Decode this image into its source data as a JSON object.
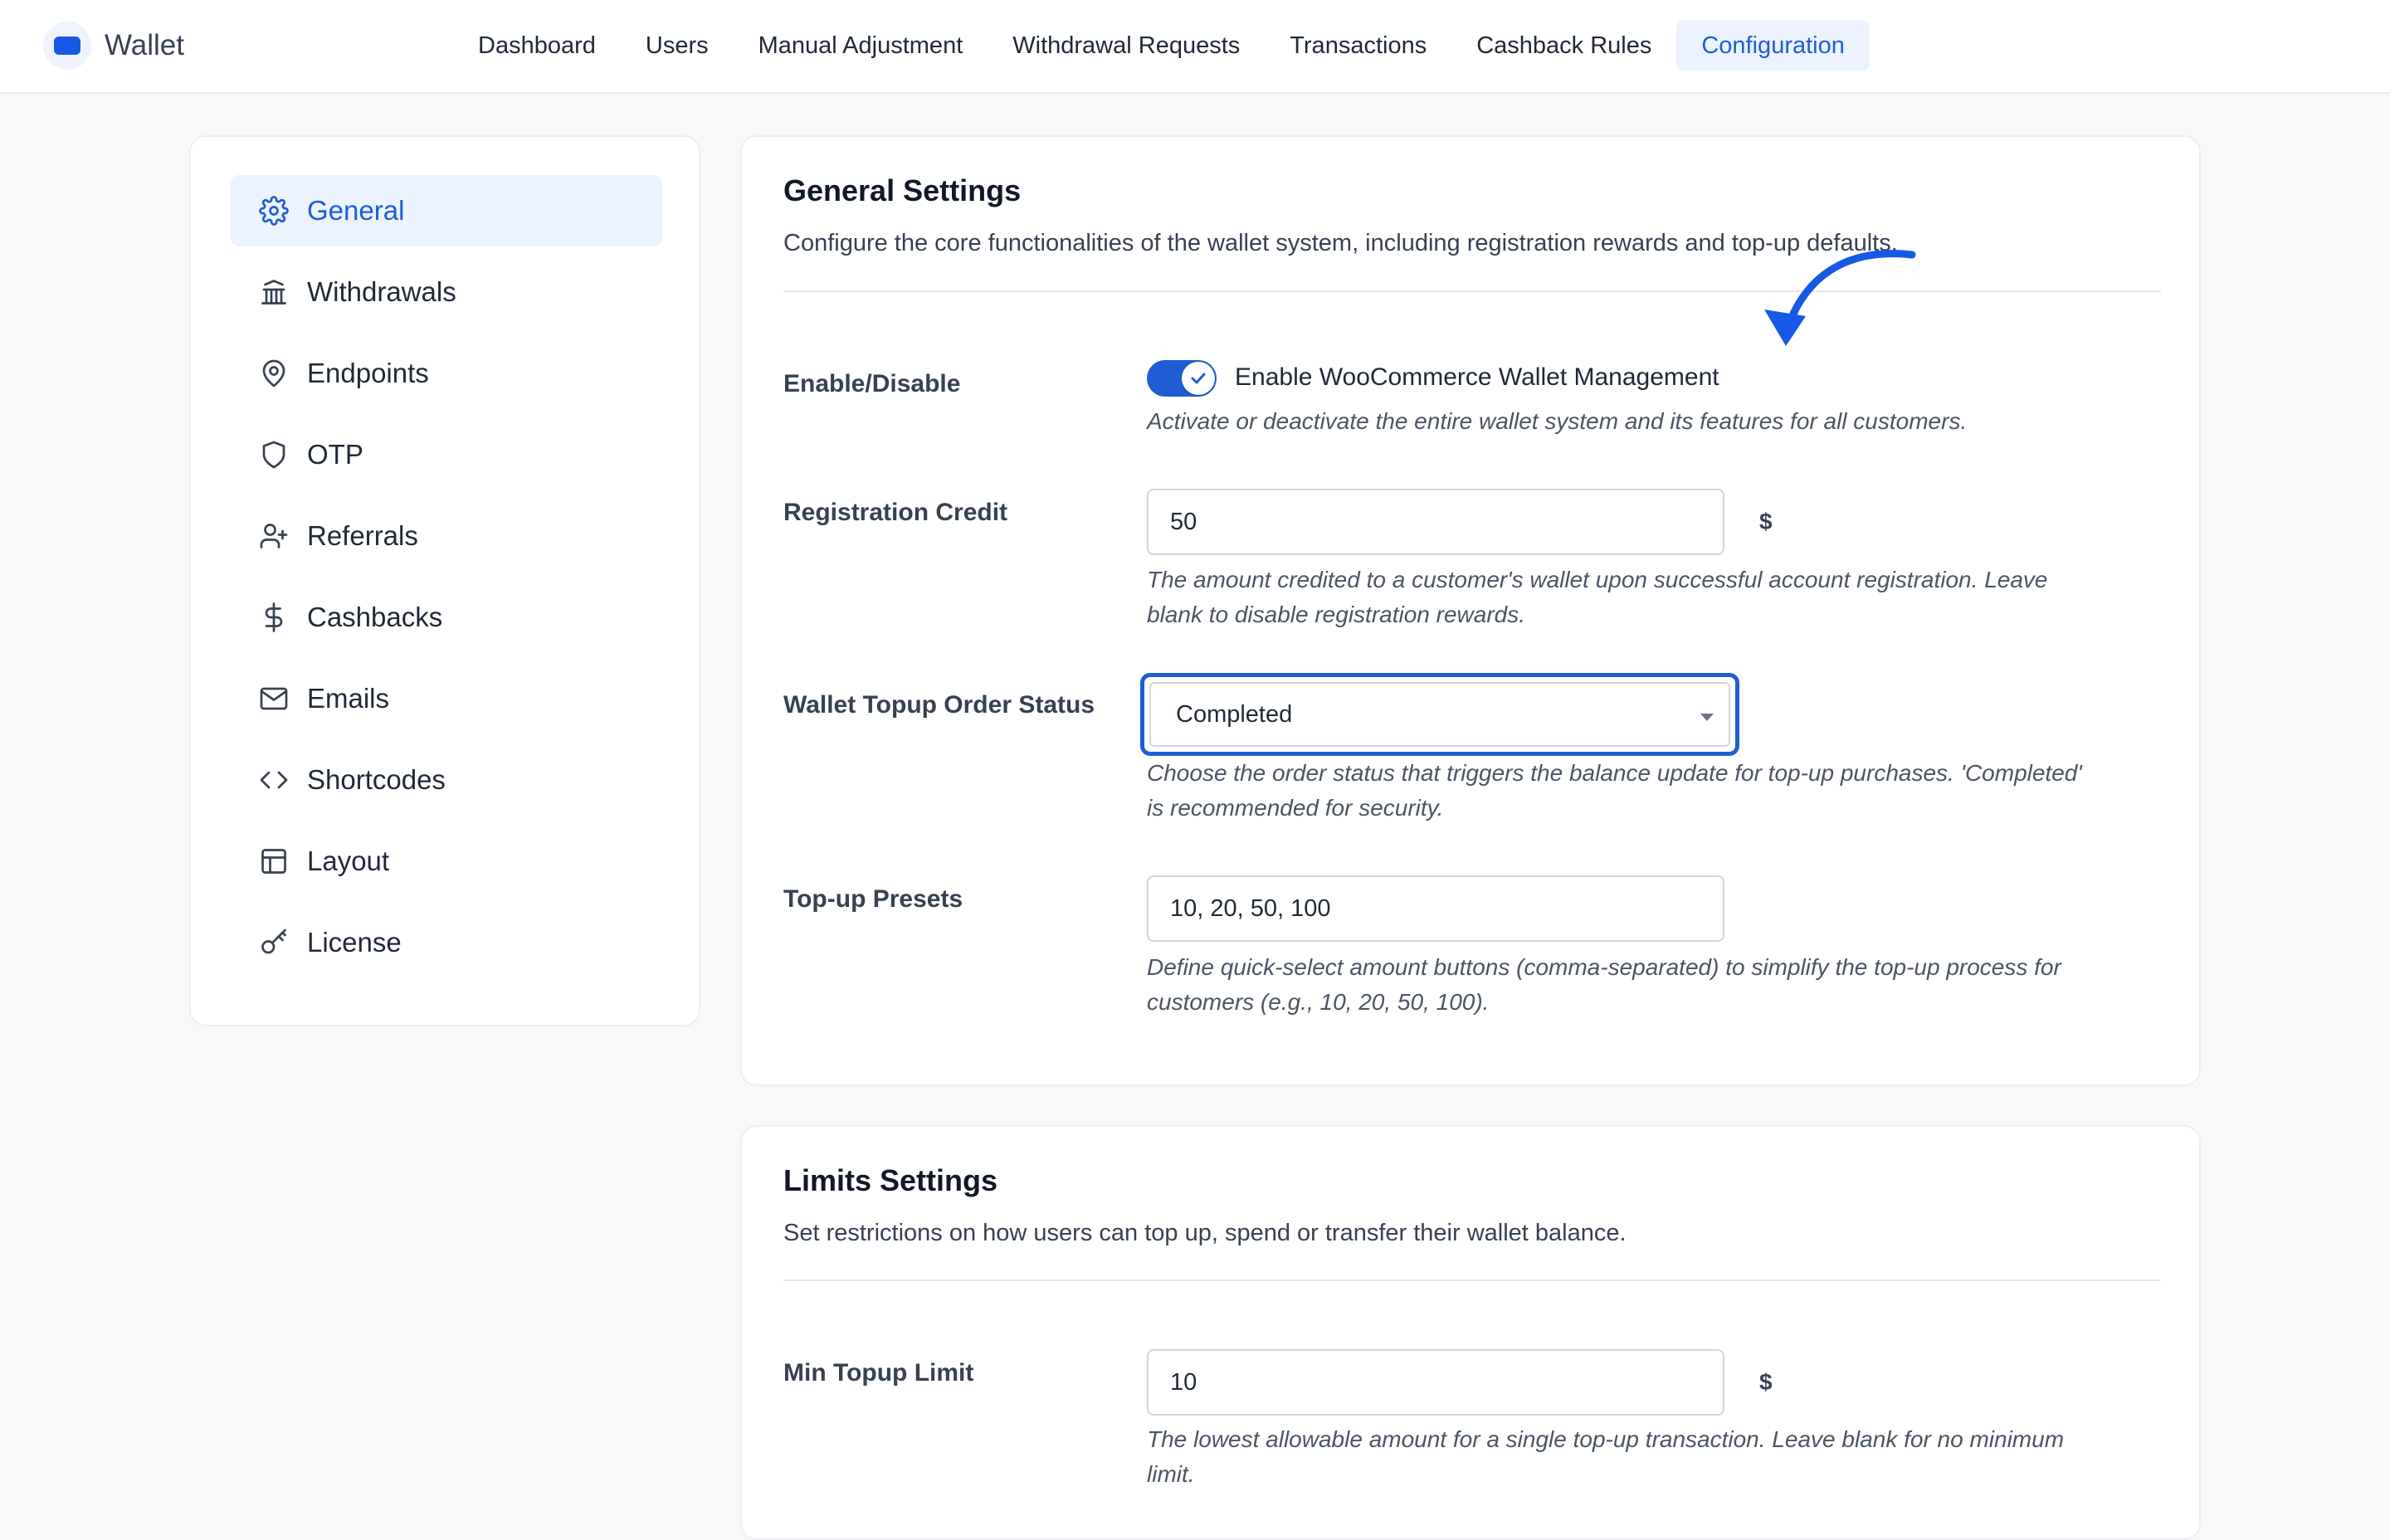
{
  "app": {
    "title": "Wallet",
    "logo_icon": "wallet-icon",
    "accent": "#1e5ed2"
  },
  "nav": {
    "items": [
      {
        "label": "Dashboard"
      },
      {
        "label": "Users"
      },
      {
        "label": "Manual Adjustment"
      },
      {
        "label": "Withdrawal Requests"
      },
      {
        "label": "Transactions"
      },
      {
        "label": "Cashback Rules"
      },
      {
        "label": "Configuration",
        "active": true
      }
    ]
  },
  "sidebar": {
    "items": [
      {
        "label": "General",
        "icon": "gear-icon",
        "active": true
      },
      {
        "label": "Withdrawals",
        "icon": "bank-icon"
      },
      {
        "label": "Endpoints",
        "icon": "map-pin-icon"
      },
      {
        "label": "OTP",
        "icon": "shield-icon"
      },
      {
        "label": "Referrals",
        "icon": "user-plus-icon"
      },
      {
        "label": "Cashbacks",
        "icon": "dollar-icon"
      },
      {
        "label": "Emails",
        "icon": "mail-icon"
      },
      {
        "label": "Shortcodes",
        "icon": "code-icon"
      },
      {
        "label": "Layout",
        "icon": "layout-icon"
      },
      {
        "label": "License",
        "icon": "key-icon"
      }
    ]
  },
  "general": {
    "title": "General Settings",
    "description": "Configure the core functionalities of the wallet system, including registration rewards and top-up defaults.",
    "enable": {
      "label": "Enable/Disable",
      "toggle_on": true,
      "toggle_label": "Enable WooCommerce Wallet Management",
      "help": "Activate or deactivate the entire wallet system and its features for all customers."
    },
    "registration_credit": {
      "label": "Registration Credit",
      "value": "50",
      "suffix": "$",
      "help_line1": "The amount credited to a customer's wallet upon successful account registration. Leave",
      "help_line2": "blank to disable registration rewards."
    },
    "topup_status": {
      "label": "Wallet Topup Order Status",
      "selected": "Completed",
      "help_line1": "Choose the order status that triggers the balance update for top-up purchases. 'Completed'",
      "help_line2": "is recommended for security."
    },
    "topup_presets": {
      "label": "Top-up Presets",
      "value": "10, 20, 50, 100",
      "help_line1": "Define quick-select amount buttons (comma-separated) to simplify the top-up process for",
      "help_line2": "customers (e.g., 10, 20, 50, 100)."
    }
  },
  "limits": {
    "title": "Limits Settings",
    "description": "Set restrictions on how users can top up, spend or transfer their wallet balance.",
    "min_topup": {
      "label": "Min Topup Limit",
      "value": "10",
      "suffix": "$",
      "help_line1": "The lowest allowable amount for a single top-up transaction. Leave blank for no minimum",
      "help_line2": "limit."
    }
  }
}
